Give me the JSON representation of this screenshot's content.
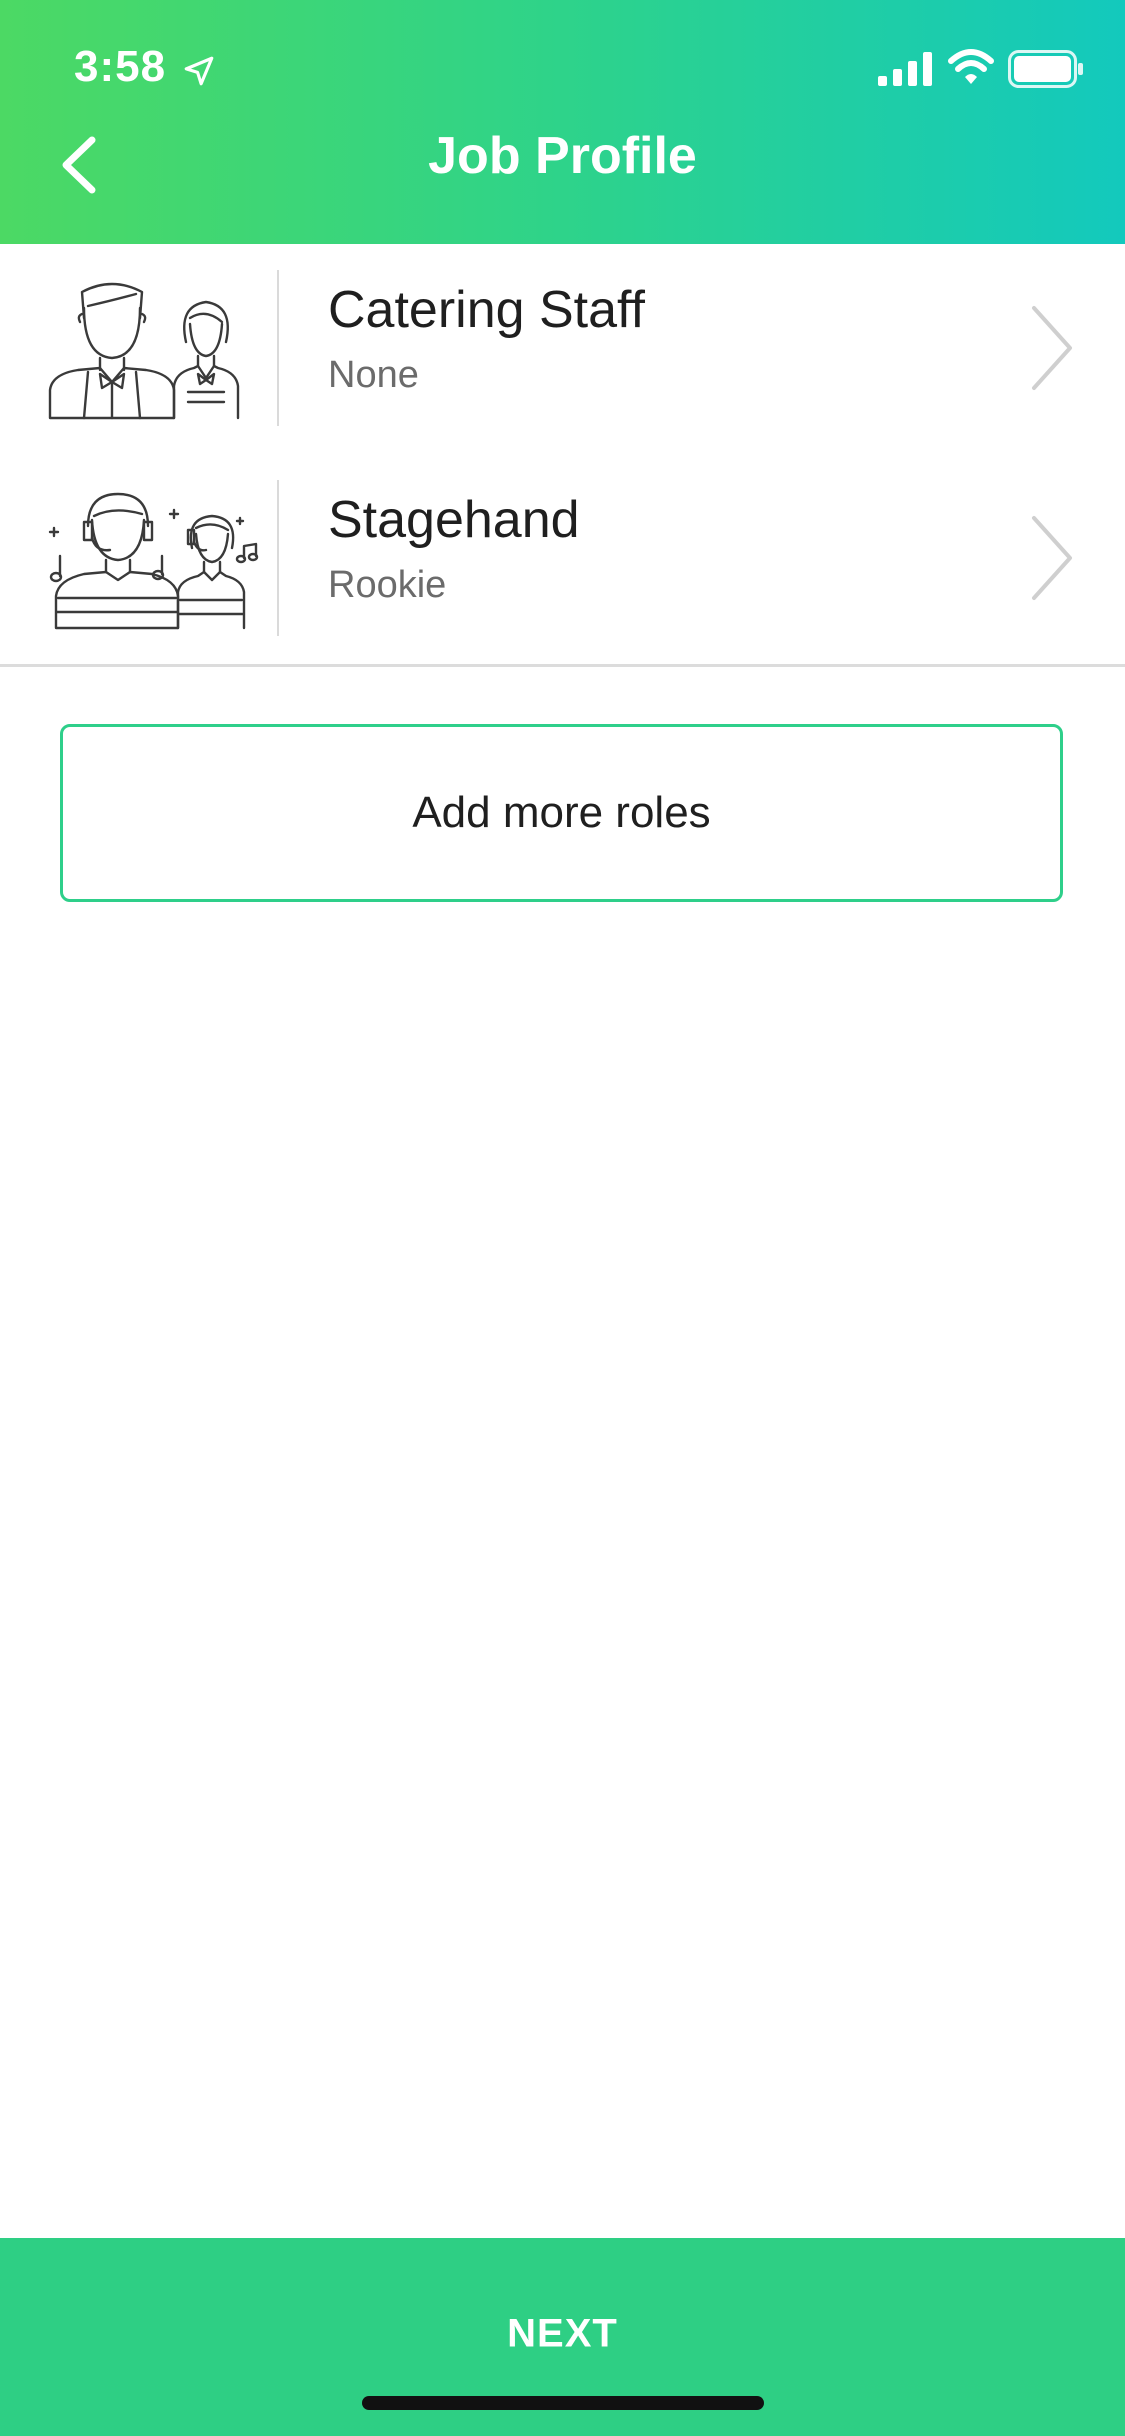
{
  "status_bar": {
    "time": "3:58",
    "icons": [
      "location-arrow-icon",
      "cellular-signal-icon",
      "wifi-icon",
      "battery-icon"
    ]
  },
  "header": {
    "title": "Job Profile",
    "back_icon": "chevron-left-icon",
    "gradient": [
      "#4cd964",
      "#13c9bd"
    ]
  },
  "roles": [
    {
      "name": "Catering Staff",
      "level": "None",
      "illustration": "catering-staff-icon"
    },
    {
      "name": "Stagehand",
      "level": "Rookie",
      "illustration": "stagehand-icon"
    }
  ],
  "add_roles": {
    "label": "Add more roles",
    "border_color": "#2ecf8a"
  },
  "footer": {
    "next_label": "NEXT",
    "color": "#2ecf84"
  }
}
